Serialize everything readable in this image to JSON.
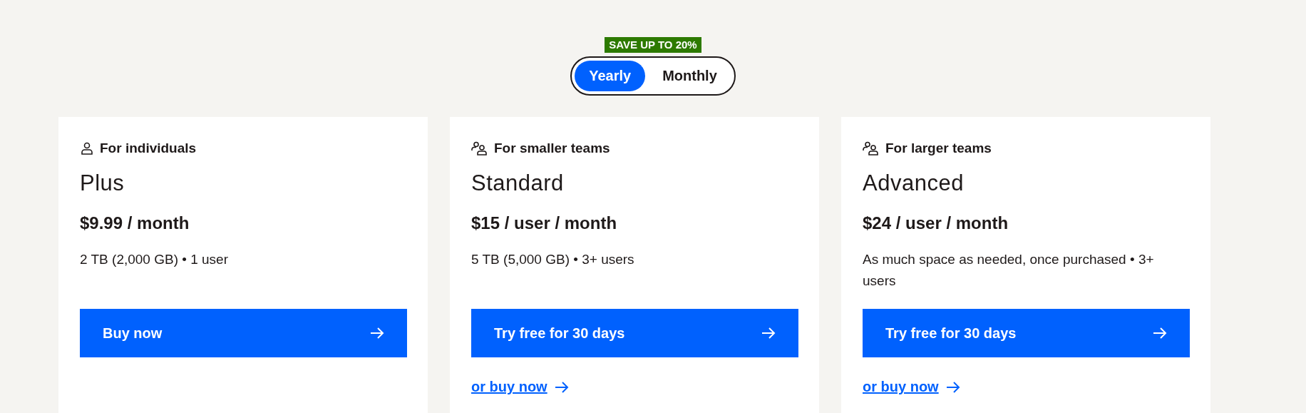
{
  "billing": {
    "badge": "SAVE UP TO 20%",
    "options": [
      {
        "label": "Yearly",
        "selected": true
      },
      {
        "label": "Monthly",
        "selected": false
      }
    ]
  },
  "plans": [
    {
      "kind": "individual",
      "audience": "For individuals",
      "name": "Plus",
      "price": "$9.99 / month",
      "details": "2 TB (2,000 GB) • 1 user",
      "cta": "Buy now"
    },
    {
      "kind": "team",
      "audience": "For smaller teams",
      "name": "Standard",
      "price": "$15 / user / month",
      "details": "5 TB (5,000 GB) • 3+ users",
      "cta": "Try free for 30 days",
      "secondary_link": "or buy now"
    },
    {
      "kind": "team",
      "audience": "For larger teams",
      "name": "Advanced",
      "price": "$24 / user / month",
      "details": "As much space as needed, once purchased • 3+ users",
      "cta": "Try free for 30 days",
      "secondary_link": "or buy now"
    }
  ]
}
